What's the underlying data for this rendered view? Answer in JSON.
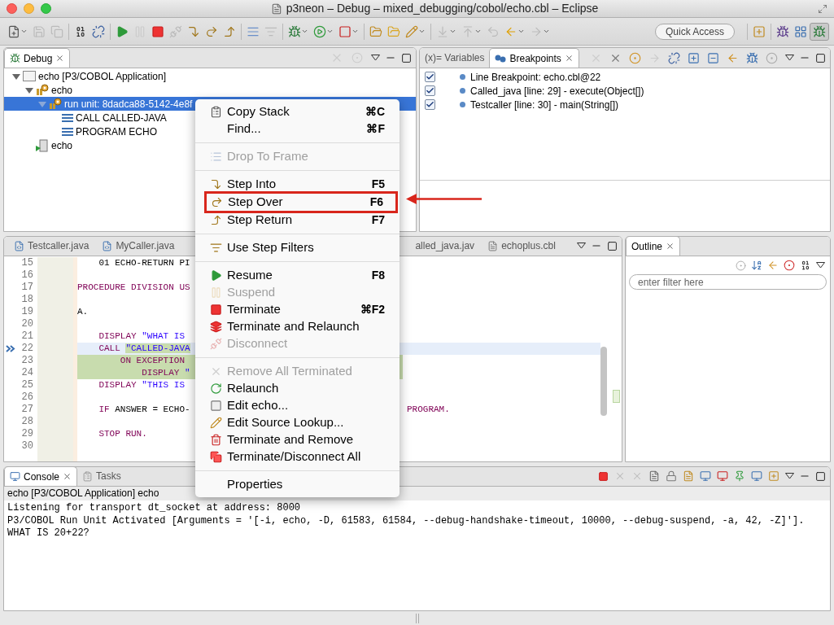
{
  "window": {
    "title": "p3neon – Debug – mixed_debugging/cobol/echo.cbl – Eclipse"
  },
  "toolbar": {
    "quick_access_placeholder": "Quick Access"
  },
  "debug_view": {
    "tab": "Debug",
    "tree": [
      {
        "label": "echo [P3/COBOL Application]",
        "kind": "launch",
        "expanded": true,
        "selected": false,
        "children": [
          {
            "label": "echo",
            "kind": "target",
            "expanded": true,
            "selected": false,
            "children": [
              {
                "label": "run unit: 8dadca88-5142-4e8f",
                "kind": "thread",
                "expanded": true,
                "selected": true,
                "children": [
                  {
                    "label": "CALL CALLED-JAVA",
                    "kind": "frame",
                    "selected": false
                  },
                  {
                    "label": "PROGRAM ECHO",
                    "kind": "frame",
                    "selected": false
                  }
                ]
              }
            ]
          },
          {
            "label": "echo",
            "kind": "process",
            "selected": false
          }
        ]
      }
    ]
  },
  "breakpoints_view": {
    "tabs": [
      {
        "label": "(x)= Variables",
        "selected": false
      },
      {
        "label": "Breakpoints",
        "selected": true
      }
    ],
    "items": [
      {
        "label": "Line Breakpoint: echo.cbl@22",
        "checked": true
      },
      {
        "label": "Called_java [line: 29] - execute(Object[])",
        "checked": true
      },
      {
        "label": "Testcaller [line: 30] - main(String[])",
        "checked": true
      }
    ]
  },
  "editor": {
    "tabs": [
      {
        "label": "Testcaller.java",
        "kind": "java",
        "selected": false
      },
      {
        "label": "MyCaller.java",
        "kind": "java",
        "selected": false
      },
      {
        "label": "alled_java.jav",
        "kind": "plain",
        "selected": false
      },
      {
        "label": "echoplus.cbl",
        "kind": "text",
        "selected": false
      }
    ],
    "lines": [
      {
        "number": "15",
        "current": false,
        "marked": false,
        "segments": [
          {
            "text": "    01 ECHO-RETURN PI",
            "kind": "plain"
          }
        ]
      },
      {
        "number": "16",
        "current": false,
        "marked": false
      },
      {
        "number": "17",
        "current": false,
        "marked": false,
        "segments": [
          {
            "text": "PROCEDURE DIVISION US",
            "kind": "keyword"
          }
        ]
      },
      {
        "number": "18",
        "current": false,
        "marked": false
      },
      {
        "number": "19",
        "current": false,
        "marked": false,
        "segments": [
          {
            "text": "A.",
            "kind": "plain"
          }
        ]
      },
      {
        "number": "20",
        "current": false,
        "marked": false
      },
      {
        "number": "21",
        "current": false,
        "marked": false,
        "segments": [
          {
            "text": "    DISPLAY ",
            "kind": "keyword"
          },
          {
            "text": "\"WHAT IS ",
            "kind": "string"
          }
        ]
      },
      {
        "number": "22",
        "current": true,
        "marked": false,
        "segments": [
          {
            "text": "    CALL ",
            "kind": "keyword"
          },
          {
            "text": "\"CALLED-JAVA",
            "kind": "string",
            "marked": true
          }
        ]
      },
      {
        "number": "23",
        "current": false,
        "marked": true,
        "segments": [
          {
            "text": "        ON EXCEPTION",
            "kind": "keyword"
          }
        ]
      },
      {
        "number": "24",
        "current": false,
        "marked": true,
        "segments": [
          {
            "text": "            DISPLAY ",
            "kind": "keyword"
          },
          {
            "text": "\"",
            "kind": "string"
          }
        ]
      },
      {
        "number": "25",
        "current": false,
        "marked": false,
        "segments": [
          {
            "text": "    DISPLAY ",
            "kind": "keyword"
          },
          {
            "text": "\"THIS IS ",
            "kind": "string"
          }
        ]
      },
      {
        "number": "26",
        "current": false,
        "marked": false
      },
      {
        "number": "27",
        "current": false,
        "marked": false,
        "segments": [
          {
            "text": "    IF",
            "kind": "keyword"
          },
          {
            "text": " ANSWER = ECHO-",
            "kind": "plain"
          }
        ],
        "right": "PROGRAM."
      },
      {
        "number": "28",
        "current": false,
        "marked": false
      },
      {
        "number": "29",
        "current": false,
        "marked": false,
        "segments": [
          {
            "text": "    STOP RUN.",
            "kind": "keyword"
          }
        ]
      },
      {
        "number": "30",
        "current": false,
        "marked": false
      }
    ]
  },
  "outline_view": {
    "tab": "Outline",
    "filter_placeholder": "enter filter here"
  },
  "console_view": {
    "tabs": [
      {
        "label": "Console",
        "selected": true
      },
      {
        "label": "Tasks",
        "selected": false
      }
    ],
    "header": "echo [P3/COBOL Application] echo",
    "output": [
      "Listening for transport dt_socket at address: 8000",
      "P3/COBOL Run Unit Activated [Arguments = '[-i, echo, -D, 61583, 61584, --debug-handshake-timeout, 10000, --debug-suspend, -a, 42, -Z]'].",
      "WHAT IS 20+22?"
    ]
  },
  "context_menu": [
    {
      "kind": "item",
      "label": "Copy Stack",
      "shortcut": "⌘C",
      "disabled": false,
      "highlighted": false
    },
    {
      "kind": "item",
      "label": "Find...",
      "shortcut": "⌘F",
      "disabled": false,
      "highlighted": false
    },
    {
      "kind": "separator"
    },
    {
      "kind": "item",
      "label": "Drop To Frame",
      "disabled": true,
      "highlighted": false
    },
    {
      "kind": "separator"
    },
    {
      "kind": "item",
      "label": "Step Into",
      "shortcut": "F5",
      "disabled": false,
      "highlighted": false
    },
    {
      "kind": "item",
      "label": "Step Over",
      "shortcut": "F6",
      "disabled": false,
      "highlighted": true
    },
    {
      "kind": "item",
      "label": "Step Return",
      "shortcut": "F7",
      "disabled": false,
      "highlighted": false
    },
    {
      "kind": "separator"
    },
    {
      "kind": "item",
      "label": "Use Step Filters",
      "disabled": false,
      "highlighted": false
    },
    {
      "kind": "separator"
    },
    {
      "kind": "item",
      "label": "Resume",
      "shortcut": "F8",
      "disabled": false,
      "highlighted": false
    },
    {
      "kind": "item",
      "label": "Suspend",
      "disabled": true,
      "highlighted": false
    },
    {
      "kind": "item",
      "label": "Terminate",
      "shortcut": "⌘F2",
      "disabled": false,
      "highlighted": false
    },
    {
      "kind": "item",
      "label": "Terminate and Relaunch",
      "disabled": false,
      "highlighted": false
    },
    {
      "kind": "item",
      "label": "Disconnect",
      "disabled": true,
      "highlighted": false
    },
    {
      "kind": "separator"
    },
    {
      "kind": "item",
      "label": "Remove All Terminated",
      "disabled": true,
      "highlighted": false
    },
    {
      "kind": "item",
      "label": "Relaunch",
      "disabled": false,
      "highlighted": false
    },
    {
      "kind": "item",
      "label": "Edit echo...",
      "disabled": false,
      "highlighted": false
    },
    {
      "kind": "item",
      "label": "Edit Source Lookup...",
      "disabled": false,
      "highlighted": false
    },
    {
      "kind": "item",
      "label": "Terminate and Remove",
      "disabled": false,
      "highlighted": false
    },
    {
      "kind": "item",
      "label": "Terminate/Disconnect All",
      "disabled": false,
      "highlighted": false
    },
    {
      "kind": "separator"
    },
    {
      "kind": "item",
      "label": "Properties",
      "disabled": false,
      "highlighted": false
    }
  ]
}
